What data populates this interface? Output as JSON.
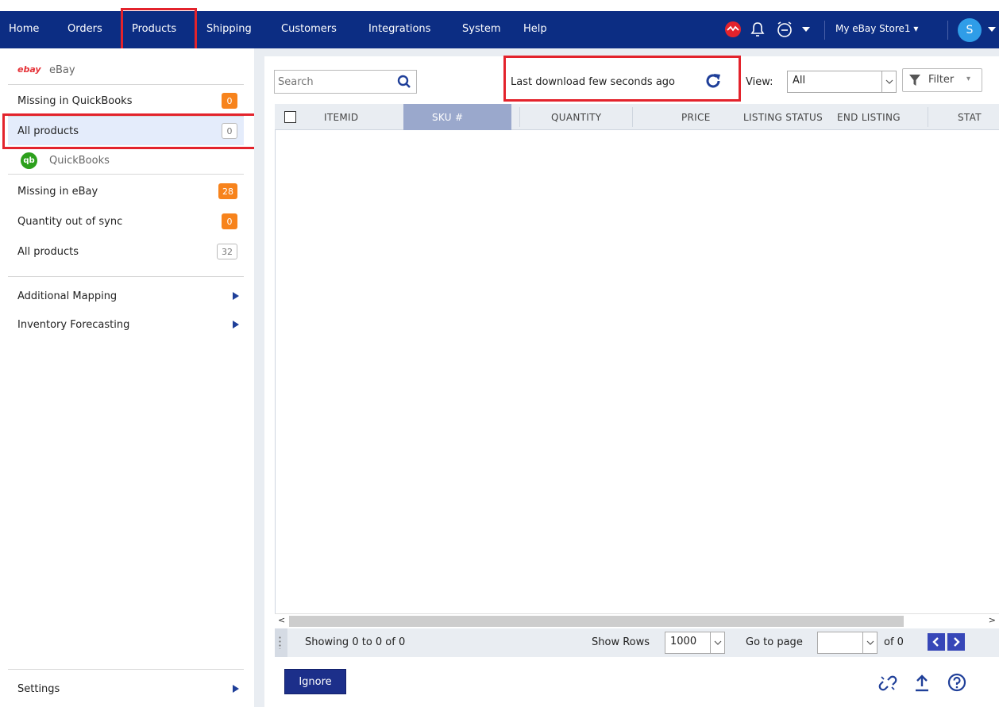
{
  "topnav": {
    "items": [
      {
        "label": "Home"
      },
      {
        "label": "Orders"
      },
      {
        "label": "Products"
      },
      {
        "label": "Shipping"
      },
      {
        "label": "Customers"
      },
      {
        "label": "Integrations"
      },
      {
        "label": "System"
      },
      {
        "label": "Help"
      }
    ],
    "store_label": "My eBay Store1",
    "avatar_letter": "S",
    "icons": [
      "alert-badge-icon",
      "bell-icon",
      "alarm-clock-icon",
      "chevron-down-icon"
    ]
  },
  "sidebar": {
    "ebay_section": {
      "logo_text": "ebay",
      "title": "eBay"
    },
    "ebay_items": [
      {
        "label": "Missing in QuickBooks",
        "count": "0",
        "style": "orange"
      },
      {
        "label": "All products",
        "count": "0",
        "style": "outline"
      }
    ],
    "qb_section": {
      "logo_text": "qb",
      "title": "QuickBooks"
    },
    "qb_items": [
      {
        "label": "Missing in eBay",
        "count": "28",
        "style": "orange"
      },
      {
        "label": "Quantity out of sync",
        "count": "0",
        "style": "orange"
      },
      {
        "label": "All products",
        "count": "32",
        "style": "outline"
      }
    ],
    "menus": [
      {
        "label": "Additional Mapping"
      },
      {
        "label": "Inventory Forecasting"
      }
    ],
    "settings_label": "Settings"
  },
  "toolbar": {
    "search_placeholder": "Search",
    "last_download": "Last download few seconds ago",
    "view_label": "View:",
    "view_value": "All",
    "filter_label": "Filter"
  },
  "grid": {
    "columns": [
      "ITEMID",
      "SKU #",
      "QUANTITY",
      "PRICE",
      "LISTING STATUS",
      "END LISTING",
      "STAT"
    ]
  },
  "footer": {
    "showing": "Showing 0 to 0 of 0",
    "show_rows_label": "Show Rows",
    "show_rows_value": "1000",
    "goto_label": "Go to page",
    "page_value": "",
    "of_label": "of 0"
  },
  "actions": {
    "ignore_label": "Ignore"
  },
  "colors": {
    "nav_bg": "#0c2d83",
    "accent_orange": "#f7831c",
    "highlight_red": "#e3232c",
    "qb_green": "#2ca01c"
  }
}
